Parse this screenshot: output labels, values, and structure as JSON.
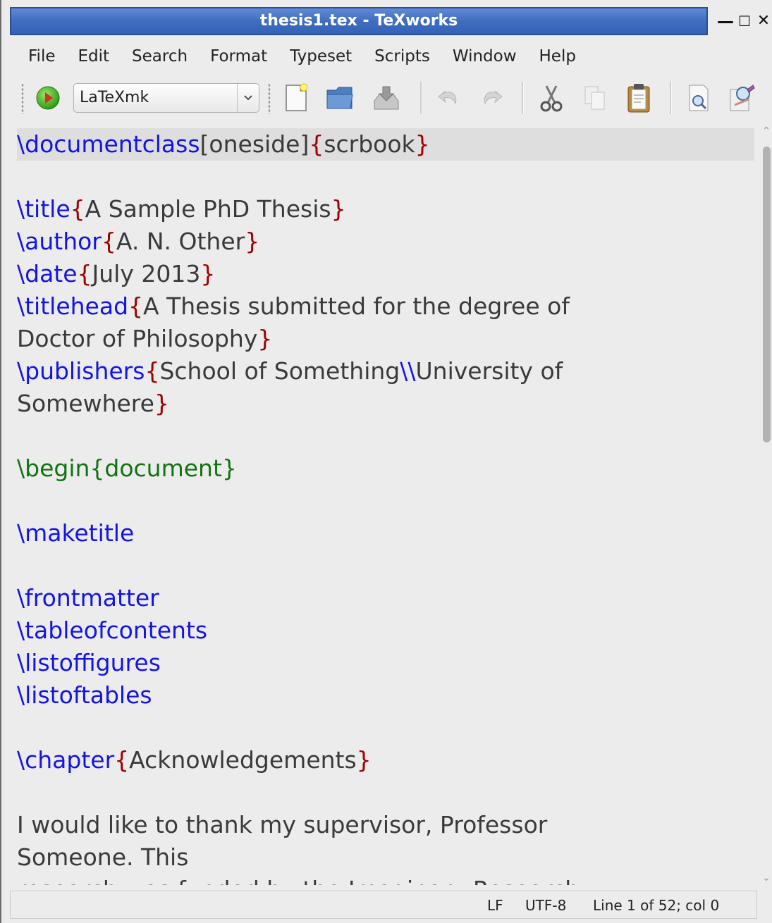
{
  "window": {
    "title": "thesis1.tex - TeXworks",
    "controls": {
      "minimize": "—",
      "maximize": "☐",
      "close": "✕"
    }
  },
  "menu": {
    "items": [
      "File",
      "Edit",
      "Search",
      "Format",
      "Typeset",
      "Scripts",
      "Window",
      "Help"
    ]
  },
  "toolbar": {
    "typeset_engine": "LaTeXmk",
    "icons": [
      "typeset-run-icon",
      "new-document-icon",
      "open-folder-icon",
      "save-icon",
      "undo-icon",
      "redo-icon",
      "cut-icon",
      "copy-icon",
      "paste-icon",
      "find-icon",
      "replace-icon"
    ]
  },
  "editor": {
    "lines": [
      [
        [
          "cmd",
          "\\documentclass"
        ],
        [
          "plain",
          "[oneside]"
        ],
        [
          "brace",
          "{"
        ],
        [
          "plain",
          "scrbook"
        ],
        [
          "brace",
          "}"
        ]
      ],
      [],
      [
        [
          "cmd",
          "\\title"
        ],
        [
          "brace",
          "{"
        ],
        [
          "plain",
          "A Sample PhD Thesis"
        ],
        [
          "brace",
          "}"
        ]
      ],
      [
        [
          "cmd",
          "\\author"
        ],
        [
          "brace",
          "{"
        ],
        [
          "plain",
          "A. N. Other"
        ],
        [
          "brace",
          "}"
        ]
      ],
      [
        [
          "cmd",
          "\\date"
        ],
        [
          "brace",
          "{"
        ],
        [
          "plain",
          "July 2013"
        ],
        [
          "brace",
          "}"
        ]
      ],
      [
        [
          "cmd",
          "\\titlehead"
        ],
        [
          "brace",
          "{"
        ],
        [
          "plain",
          "A Thesis submitted for the degree of"
        ]
      ],
      [
        [
          "plain",
          "Doctor of Philosophy"
        ],
        [
          "brace",
          "}"
        ]
      ],
      [
        [
          "cmd",
          "\\publishers"
        ],
        [
          "brace",
          "{"
        ],
        [
          "plain",
          "School of Something"
        ],
        [
          "cmd",
          "\\\\"
        ],
        [
          "plain",
          "University of"
        ]
      ],
      [
        [
          "plain",
          "Somewhere"
        ],
        [
          "brace",
          "}"
        ]
      ],
      [],
      [
        [
          "env",
          "\\begin{document}"
        ]
      ],
      [],
      [
        [
          "cmd",
          "\\maketitle"
        ]
      ],
      [],
      [
        [
          "cmd",
          "\\frontmatter"
        ]
      ],
      [
        [
          "cmd",
          "\\tableofcontents"
        ]
      ],
      [
        [
          "cmd",
          "\\listoffigures"
        ]
      ],
      [
        [
          "cmd",
          "\\listoftables"
        ]
      ],
      [],
      [
        [
          "cmd",
          "\\chapter"
        ],
        [
          "brace",
          "{"
        ],
        [
          "plain",
          "Acknowledgements"
        ],
        [
          "brace",
          "}"
        ]
      ],
      [],
      [
        [
          "plain",
          "I would like to thank my supervisor, Professor"
        ]
      ],
      [
        [
          "plain",
          "Someone. This"
        ]
      ],
      [
        [
          "plain",
          "research was funded by the Imaginary Research"
        ]
      ]
    ],
    "colors": {
      "cmd": "#1414e6",
      "brace": "#a00000",
      "env": "#127312",
      "plain": "#3a3a3a"
    }
  },
  "status": {
    "line_ending": "LF",
    "encoding": "UTF-8",
    "position": "Line 1 of 52; col 0"
  }
}
